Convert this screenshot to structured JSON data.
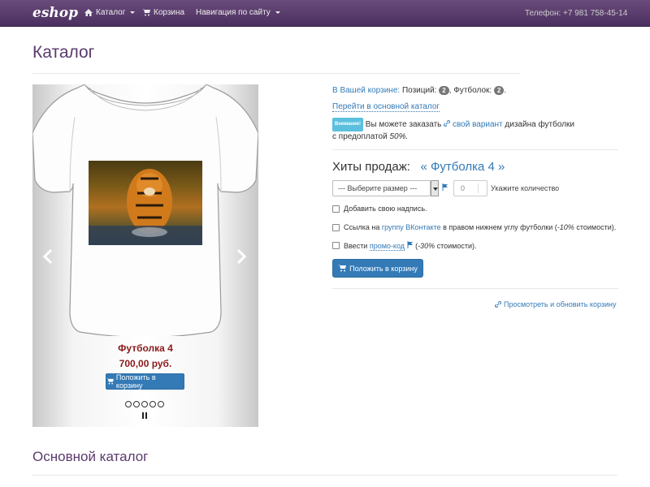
{
  "navbar": {
    "brand": "eshop",
    "catalog": "Каталог",
    "cart": "Корзина",
    "site_nav": "Навигация по сайту",
    "phone": "Телефон: +7 981 758-45-14"
  },
  "page_title": "Каталог",
  "carousel": {
    "product_name": "Футболка 4",
    "price": "700,00 руб.",
    "add_button": "Положить в корзину",
    "dots_count": 5,
    "prev_icon": "chevron-left-icon",
    "next_icon": "chevron-right-icon"
  },
  "cart_summary": {
    "in_cart": "В Вашей корзине:",
    "positions_label": "Позиций:",
    "positions_count": "2",
    "shirts_label": "Футболок:",
    "shirts_count": "2",
    "main_catalog_link": "Перейти в основной каталог"
  },
  "notice": {
    "badge": "Внимание!",
    "text1": "Вы можете заказать",
    "link": "свой вариант",
    "text2": "дизайна футболки",
    "text3": "с предоплатой",
    "percent": "50%."
  },
  "hits": {
    "label": "Хиты продаж:",
    "product": "« Футболка 4 »"
  },
  "order": {
    "size_placeholder": "--- Выберите размер ---",
    "qty_value": "0",
    "qty_label": "Укажите количество",
    "opt1": "Добавить свою надпись.",
    "opt2_a": "Ссылка на",
    "opt2_link": "группу ВКонтакте",
    "opt2_b": "в правом нижнем углу футболки (",
    "opt2_pct": "-10%",
    "opt2_c": "стоимости).",
    "opt3_a": "Ввести",
    "opt3_link": "промо-код",
    "opt3_b": "(",
    "opt3_pct": "-30%",
    "opt3_c": "стоимости).",
    "add_button": "Положить в корзину",
    "view_cart": "Просмотреть и обновить корзину"
  },
  "main_catalog_title": "Основной каталог",
  "colors": {
    "navbar": "#4b2f5e",
    "primary": "#337ab7",
    "price": "#8a1a1a",
    "heading": "#5a3a6e"
  }
}
